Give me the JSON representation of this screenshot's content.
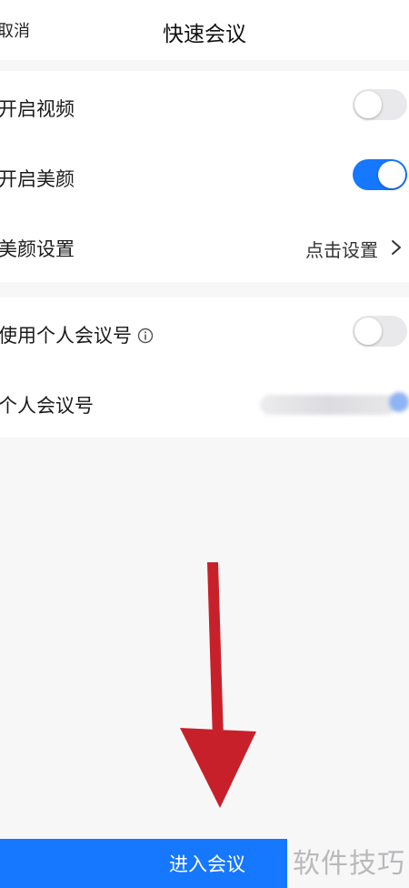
{
  "header": {
    "cancel_label": "取消",
    "title": "快速会议"
  },
  "settings": {
    "video": {
      "label": "开启视频",
      "on": false
    },
    "beauty": {
      "label": "开启美颜",
      "on": true
    },
    "beauty_settings": {
      "label": "美颜设置",
      "value": "点击设置"
    }
  },
  "personal": {
    "use_personal_id": {
      "label": "使用个人会议号",
      "on": false
    },
    "personal_id": {
      "label": "个人会议号"
    }
  },
  "footer": {
    "enter_label": "进入会议"
  },
  "watermark": "软件技巧",
  "colors": {
    "accent": "#1677ff",
    "annotation_arrow": "#c8202b"
  }
}
